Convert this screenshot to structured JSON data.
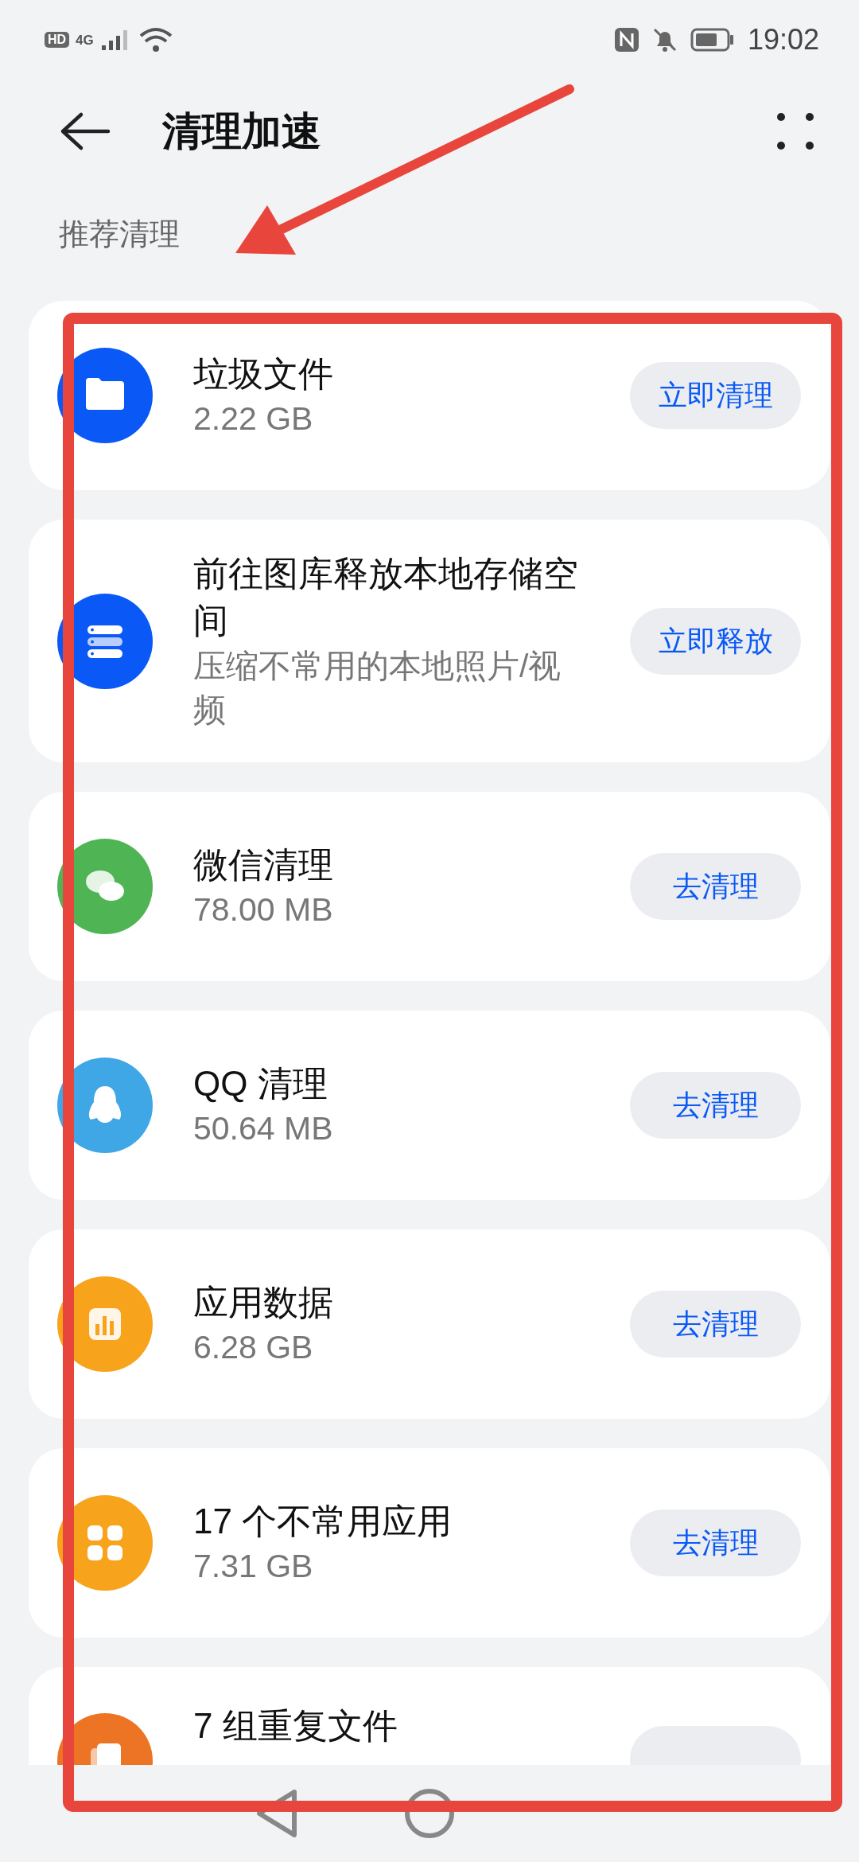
{
  "status_bar": {
    "hd_label": "HD",
    "network": "4G",
    "time": "19:02"
  },
  "header": {
    "title": "清理加速"
  },
  "section": {
    "label": "推荐清理"
  },
  "items": [
    {
      "kind": "folder",
      "color": "#0a59f7",
      "title": "垃圾文件",
      "subtitle": "2.22 GB",
      "button": "立即清理"
    },
    {
      "kind": "storage",
      "color": "#0a59f7",
      "title": "前往图库释放本地存储空间",
      "subtitle": "压缩不常用的本地照片/视频",
      "button": "立即释放"
    },
    {
      "kind": "chat",
      "color": "#4fb454",
      "title": "微信清理",
      "subtitle": "78.00 MB",
      "button": "去清理"
    },
    {
      "kind": "penguin",
      "color": "#3fa7e6",
      "title": "QQ 清理",
      "subtitle": "50.64 MB",
      "button": "去清理"
    },
    {
      "kind": "bars",
      "color": "#f7a31c",
      "title": "应用数据",
      "subtitle": "6.28 GB",
      "button": "去清理"
    },
    {
      "kind": "grid",
      "color": "#f7a31c",
      "title": "17 个不常用应用",
      "subtitle": "7.31 GB",
      "button": "去清理"
    },
    {
      "kind": "files",
      "color": "#ec7424",
      "title": "7 组重复文件"
    }
  ]
}
